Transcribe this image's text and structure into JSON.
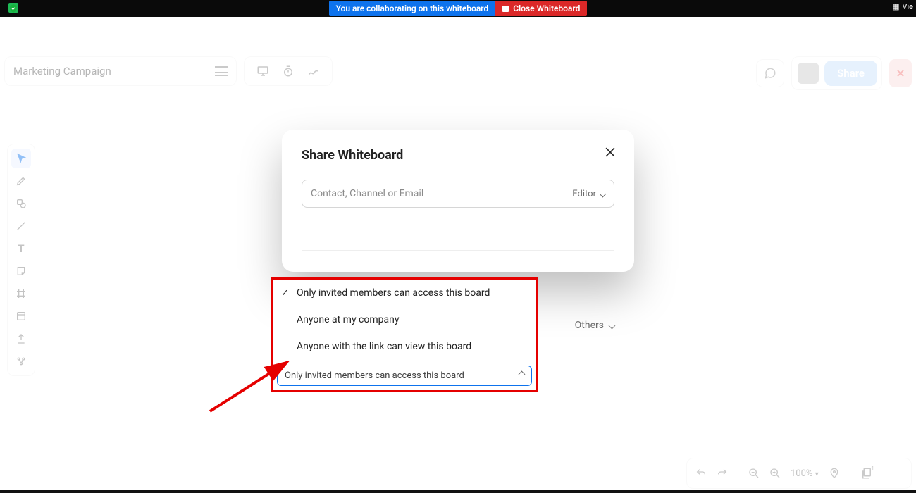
{
  "topbar": {
    "collab_banner": "You are collaborating on this whiteboard",
    "close_banner": "Close Whiteboard",
    "view_label": "Vie"
  },
  "header": {
    "title": "Marketing Campaign",
    "share_label": "Share"
  },
  "toolbar": {
    "tools": [
      "cursor",
      "pen",
      "shape",
      "line",
      "text",
      "sticky",
      "frame",
      "template",
      "upload",
      "ai"
    ]
  },
  "bottom": {
    "zoom": "100%"
  },
  "modal": {
    "title": "Share Whiteboard",
    "placeholder": "Contact, Channel or Email",
    "role_label": "Editor",
    "others_label": "Others",
    "options": {
      "opt1": "Only invited members can access this board",
      "opt2": "Anyone at my company",
      "opt3": "Anyone with the link can view this board"
    },
    "selected": "Only invited members can access this board"
  }
}
